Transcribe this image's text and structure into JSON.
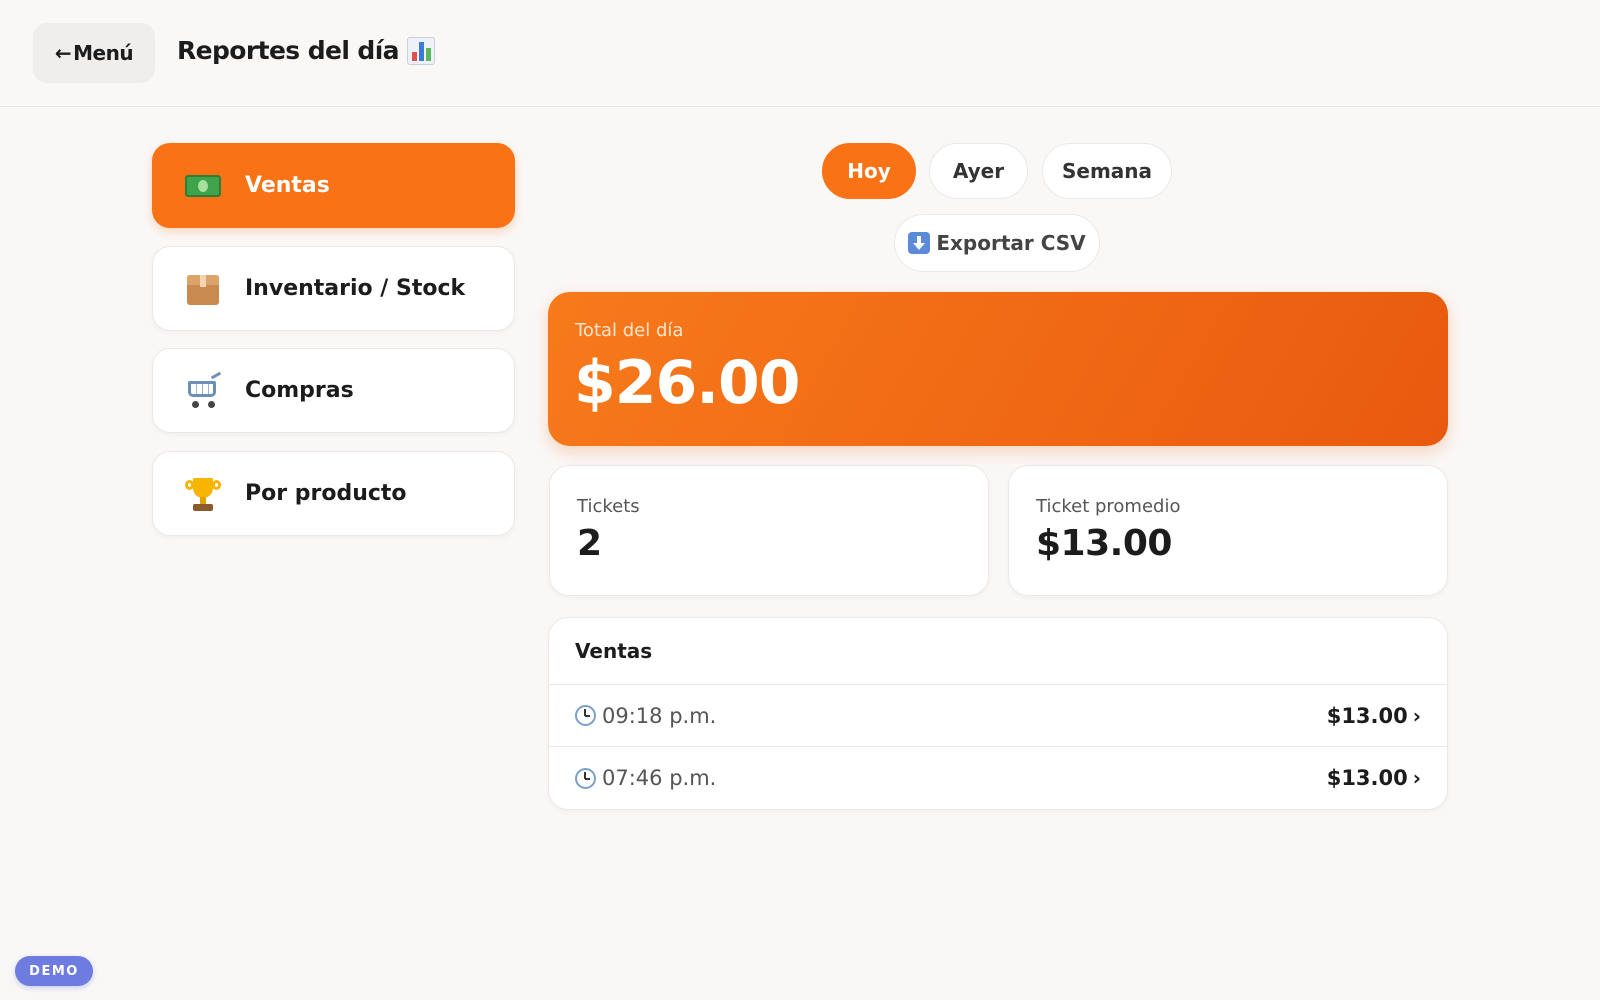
{
  "header": {
    "back_arrow": "←",
    "back_label": "Menú",
    "title": "Reportes del día",
    "title_icon": "bar-chart-icon"
  },
  "sidebar": {
    "items": [
      {
        "label": "Ventas",
        "icon": "money-icon",
        "active": true
      },
      {
        "label": "Inventario / Stock",
        "icon": "package-icon",
        "active": false
      },
      {
        "label": "Compras",
        "icon": "shopping-cart-icon",
        "active": false
      },
      {
        "label": "Por producto",
        "icon": "trophy-icon",
        "active": false
      }
    ]
  },
  "periods": {
    "items": [
      {
        "label": "Hoy",
        "active": true
      },
      {
        "label": "Ayer",
        "active": false
      },
      {
        "label": "Semana",
        "active": false
      }
    ]
  },
  "export": {
    "label": "Exportar CSV",
    "icon": "download-icon"
  },
  "total": {
    "label": "Total del día",
    "value": "$26.00"
  },
  "stats": {
    "tickets": {
      "label": "Tickets",
      "value": "2"
    },
    "average": {
      "label": "Ticket promedio",
      "value": "$13.00"
    }
  },
  "sales": {
    "title": "Ventas",
    "rows": [
      {
        "time": "09:18 p.m.",
        "amount": "$13.00"
      },
      {
        "time": "07:46 p.m.",
        "amount": "$13.00"
      }
    ],
    "chevron": "›"
  },
  "demo_badge": "DEMO",
  "colors": {
    "accent": "#f97316",
    "background": "#faf8f7",
    "demo": "#6e7ce0"
  }
}
